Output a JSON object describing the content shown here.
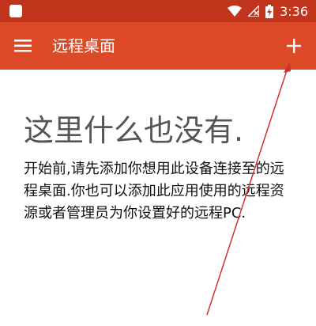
{
  "status_bar": {
    "time": "3:36"
  },
  "app_bar": {
    "title": "远程桌面"
  },
  "empty_state": {
    "heading": "这里什么也没有.",
    "description": "开始前,请先添加你想用此设备连接至的远程桌面.你也可以添加此应用使用的远程资源或者管理员为你设置好的远程PC."
  },
  "colors": {
    "app_bar": "#dd4a27",
    "status_bar": "#c1351d",
    "annotation_arrow": "#d2302a"
  }
}
